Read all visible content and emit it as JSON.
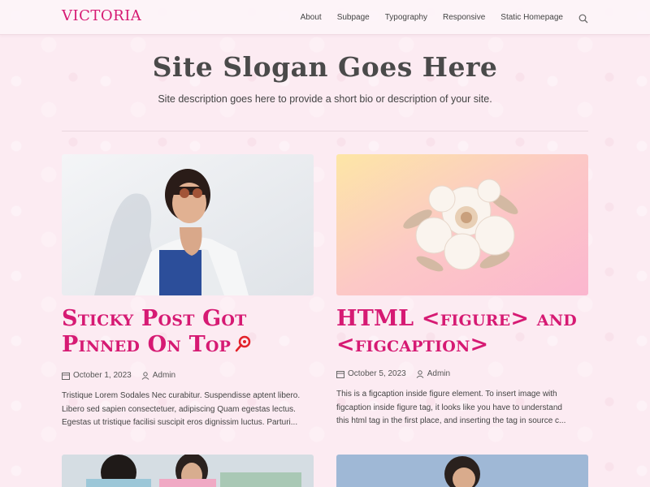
{
  "site": {
    "brand": "Victoria"
  },
  "nav": {
    "items": [
      "About",
      "Subpage",
      "Typography",
      "Responsive",
      "Static Homepage"
    ],
    "search_icon": "search-icon"
  },
  "hero": {
    "title": "Site Slogan Goes Here",
    "description": "Site description goes here to provide a short bio or description of your site."
  },
  "posts": [
    {
      "title": "Sticky Post Got Pinned On Top",
      "pinned_icon": "pin-icon",
      "date": "October 1, 2023",
      "author": "Admin",
      "excerpt_lines": [
        "Tristique Lorem Sodales Nec curabitur. Suspendisse aptent libero.",
        "Libero sed sapien consectetuer, adipiscing Quam egestas lectus.",
        "Egestas ut tristique facilisi suscipit eros dignissim luctus. Parturi..."
      ]
    },
    {
      "title": "HTML <figure> and <figcaption>",
      "date": "October 5, 2023",
      "author": "Admin",
      "excerpt_lines": [
        "This is a figcaption inside figure element. To insert image with",
        "figcaption inside figure tag, it looks like you have to understand",
        "this html tag in the first place, and inserting the tag in source c..."
      ]
    }
  ],
  "colors": {
    "accent": "#d61a73",
    "background": "#fcebf2"
  }
}
